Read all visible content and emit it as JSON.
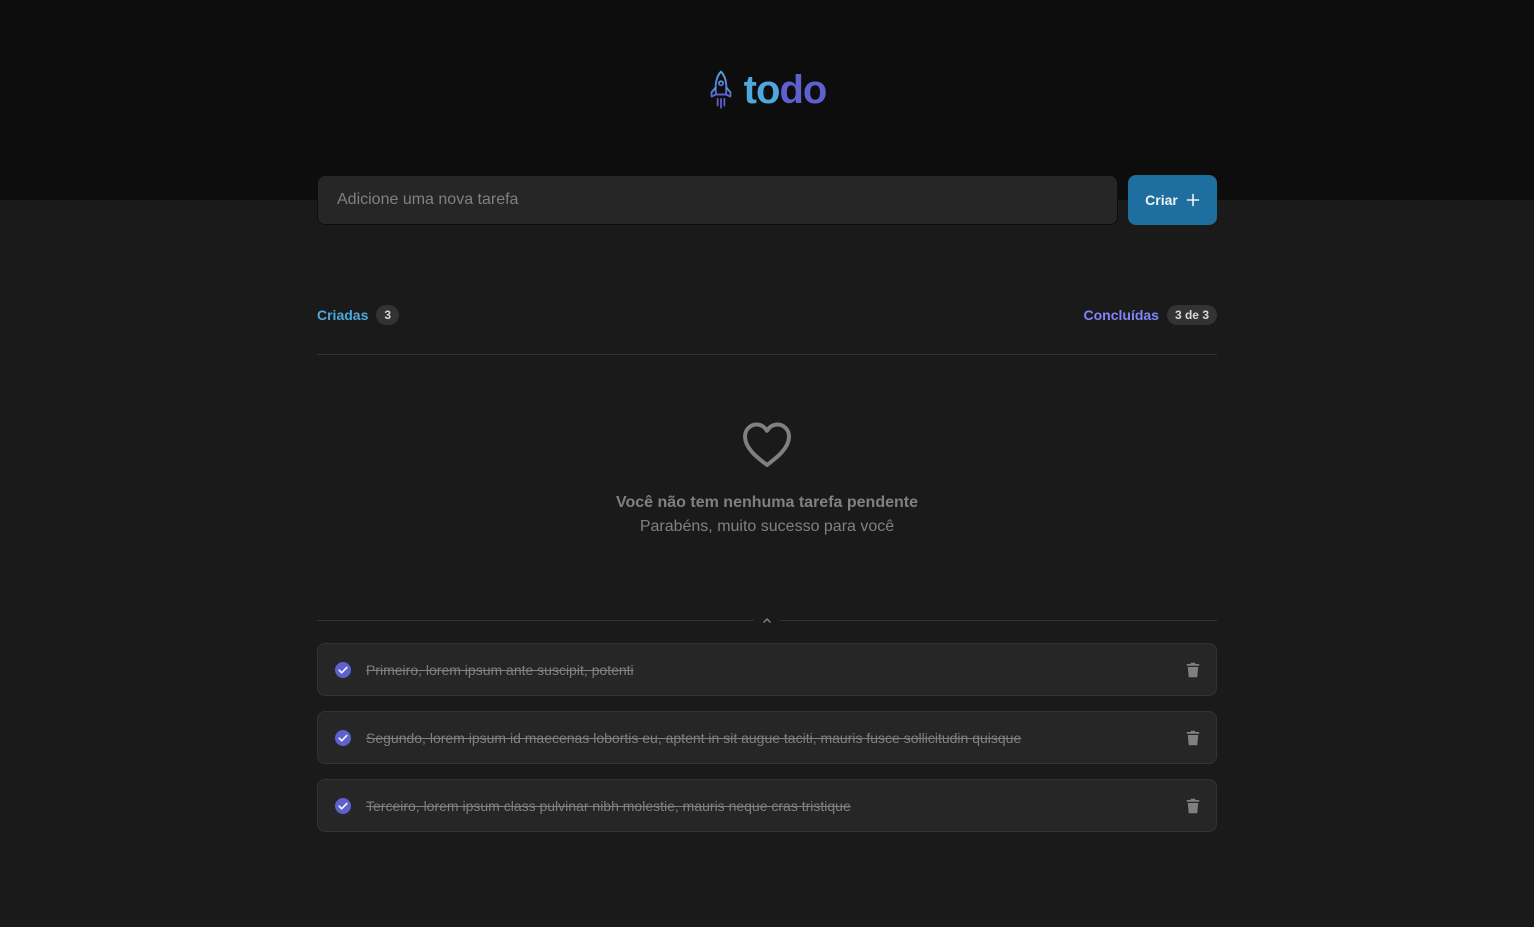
{
  "app": {
    "logo_text_1": "to",
    "logo_text_2": "do",
    "logo_icon": "rocket-icon",
    "colors": {
      "blue": "#4ea8de",
      "purple": "#5e60ce",
      "purple_light": "#8284fa",
      "button": "#1e6f9f",
      "header_bg": "#0d0d0d",
      "page_bg": "#1a1a1a"
    }
  },
  "new_task": {
    "placeholder": "Adicione uma nova tarefa",
    "value": "",
    "create_label": "Criar",
    "create_icon": "plus-icon"
  },
  "counters": {
    "created_label": "Criadas",
    "created_count": "3",
    "done_label": "Concluídas",
    "done_count": "3 de 3"
  },
  "empty": {
    "icon": "heart-icon",
    "title": "Você não tem nenhuma tarefa pendente",
    "subtitle": "Parabéns, muito sucesso para você"
  },
  "completed_section": {
    "toggle_icon": "chevron-up-icon"
  },
  "tasks": [
    {
      "text": "Primeiro, lorem ipsum ante suscipit, potenti",
      "done": true
    },
    {
      "text": "Segundo, lorem ipsum id maecenas lobortis eu, aptent in sit augue taciti, mauris fusce sollicitudin quisque",
      "done": true
    },
    {
      "text": "Terceiro, lorem ipsum class pulvinar nibh molestie, mauris neque cras tristique",
      "done": true
    }
  ]
}
